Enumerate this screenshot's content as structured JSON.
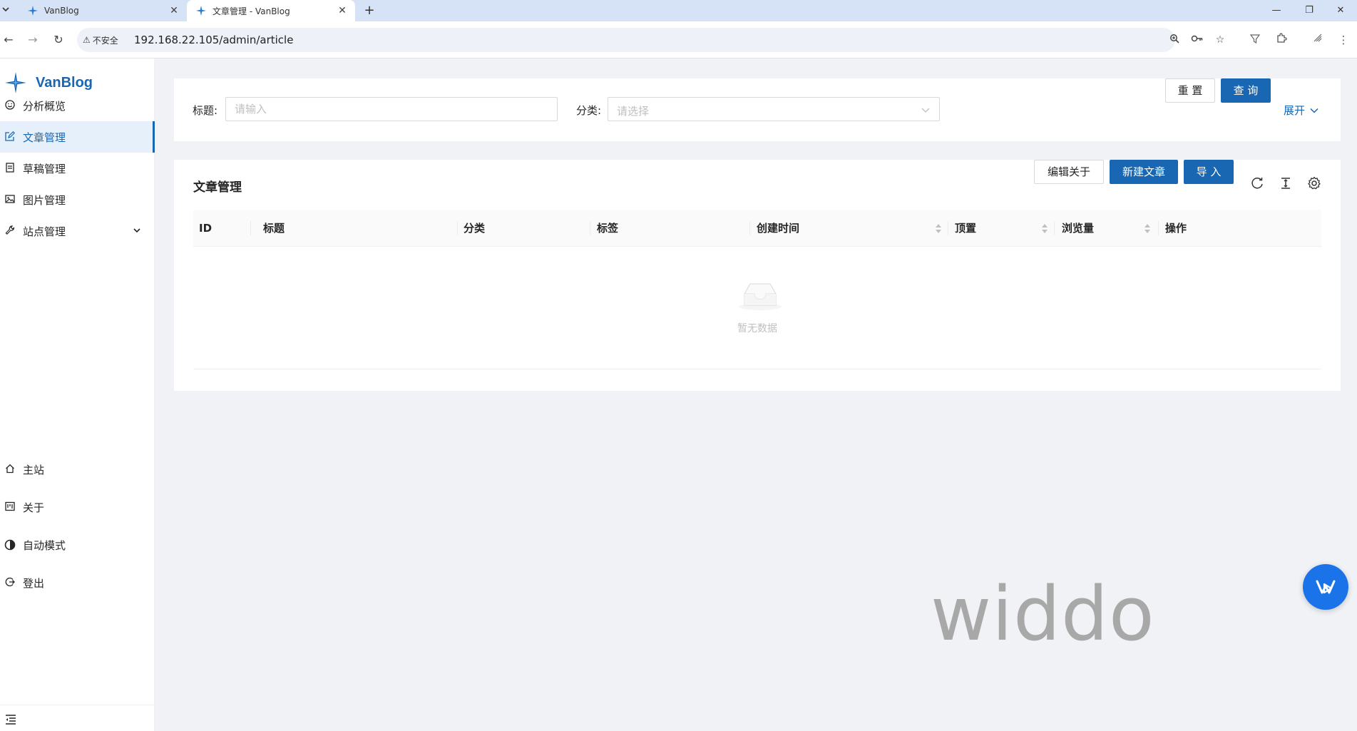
{
  "browser": {
    "tabs": [
      {
        "title": "VanBlog",
        "active": false
      },
      {
        "title": "文章管理 - VanBlog",
        "active": true
      }
    ],
    "security_label": "不安全",
    "url": "192.168.22.105/admin/article"
  },
  "sidebar": {
    "brand": "VanBlog",
    "items": [
      {
        "label": "分析概览",
        "icon": "smile-icon"
      },
      {
        "label": "文章管理",
        "icon": "edit-icon",
        "selected": true
      },
      {
        "label": "草稿管理",
        "icon": "container-icon"
      },
      {
        "label": "图片管理",
        "icon": "picture-icon"
      },
      {
        "label": "站点管理",
        "icon": "tool-icon",
        "has_submenu": true
      }
    ],
    "bottom_items": [
      {
        "label": "主站",
        "icon": "home-icon"
      },
      {
        "label": "关于",
        "icon": "project-icon"
      },
      {
        "label": "自动模式",
        "icon": "contrast-icon"
      },
      {
        "label": "登出",
        "icon": "logout-icon"
      }
    ]
  },
  "filter": {
    "title_label": "标题:",
    "title_placeholder": "请输入",
    "category_label": "分类:",
    "category_placeholder": "请选择",
    "reset_label": "重 置",
    "query_label": "查 询",
    "expand_label": "展开"
  },
  "table": {
    "title": "文章管理",
    "edit_about_label": "编辑关于",
    "new_article_label": "新建文章",
    "import_label": "导 入",
    "columns": [
      "ID",
      "标题",
      "分类",
      "标签",
      "创建时间",
      "顶置",
      "浏览量",
      "操作"
    ],
    "empty_text": "暂无数据"
  },
  "watermark": "widdo",
  "colors": {
    "primary": "#1967b2",
    "page_bg": "#f0f2f5",
    "tabbar_bg": "#d6e2f5"
  }
}
